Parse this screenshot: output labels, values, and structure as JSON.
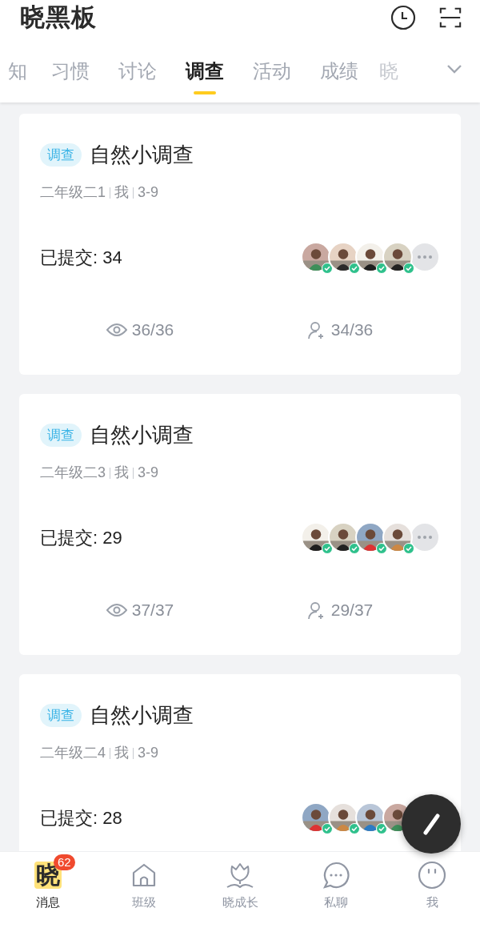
{
  "header": {
    "logo": "晓黑板"
  },
  "tabs": [
    {
      "label": "知",
      "selected": false
    },
    {
      "label": "习惯",
      "selected": false
    },
    {
      "label": "讨论",
      "selected": false
    },
    {
      "label": "调查",
      "selected": true
    },
    {
      "label": "活动",
      "selected": false
    },
    {
      "label": "成绩",
      "selected": false
    },
    {
      "label": "晓",
      "selected": false
    }
  ],
  "cards": [
    {
      "tag": "调查",
      "title": "自然小调查",
      "meta": [
        "二年级二1",
        "我",
        "3-9"
      ],
      "submitted": "已提交: 34",
      "avatars": [
        {
          "kind": "picture",
          "checked": true
        },
        {
          "kind": "picture",
          "checked": true
        },
        {
          "kind": "picture",
          "checked": true
        },
        {
          "kind": "picture",
          "checked": true
        }
      ],
      "more": true,
      "views": "36/36",
      "responses": "34/36"
    },
    {
      "tag": "调查",
      "title": "自然小调查",
      "meta": [
        "二年级二3",
        "我",
        "3-9"
      ],
      "submitted": "已提交: 29",
      "avatars": [
        {
          "kind": "picture",
          "checked": true
        },
        {
          "kind": "picture",
          "checked": true
        },
        {
          "kind": "picture",
          "checked": true
        },
        {
          "kind": "picture",
          "checked": true
        }
      ],
      "more": true,
      "views": "37/37",
      "responses": "29/37"
    },
    {
      "tag": "调查",
      "title": "自然小调查",
      "meta": [
        "二年级二4",
        "我",
        "3-9"
      ],
      "submitted": "已提交: 28",
      "avatars": [
        {
          "kind": "picture",
          "checked": true
        },
        {
          "kind": "picture",
          "checked": true
        },
        {
          "kind": "picture",
          "checked": true
        },
        {
          "kind": "picture"
        }
      ]
    }
  ],
  "nav": [
    {
      "kind": "logo",
      "glyph": "晓",
      "label": "消息",
      "badge": "62",
      "selected": true
    },
    {
      "kind": "home",
      "label": "班级",
      "selected": false
    },
    {
      "kind": "tulip",
      "label": "晓成长",
      "selected": false
    },
    {
      "kind": "chat",
      "label": "私聊",
      "selected": false
    },
    {
      "kind": "face",
      "label": "我",
      "selected": false
    }
  ]
}
